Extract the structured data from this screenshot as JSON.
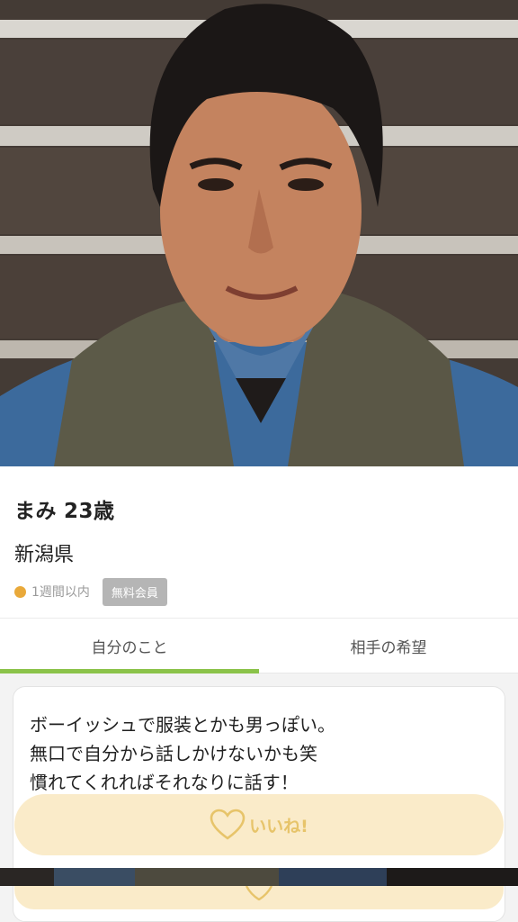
{
  "profile": {
    "name": "まみ",
    "age": "23歳",
    "location": "新潟県",
    "last_login": "1週間以内",
    "member_type": "無料会員",
    "photo_icon": "profile-photo"
  },
  "tabs": [
    {
      "label": "自分のこと",
      "active": true
    },
    {
      "label": "相手の希望",
      "active": false
    }
  ],
  "intro": {
    "text": "ボーイッシュで服装とかも男っぽい。\n無口で自分から話しかけないかも笑\n慣れてくれればそれなりに話す！"
  },
  "like_button": {
    "label": "いいね!",
    "icon": "heart-outline-icon"
  },
  "colors": {
    "accent_tab": "#8bc34a",
    "status_dot": "#e9a93a",
    "like_bg": "#fae9c4",
    "like_text": "#e7c46a",
    "badge_bg": "#b5b5b5"
  }
}
